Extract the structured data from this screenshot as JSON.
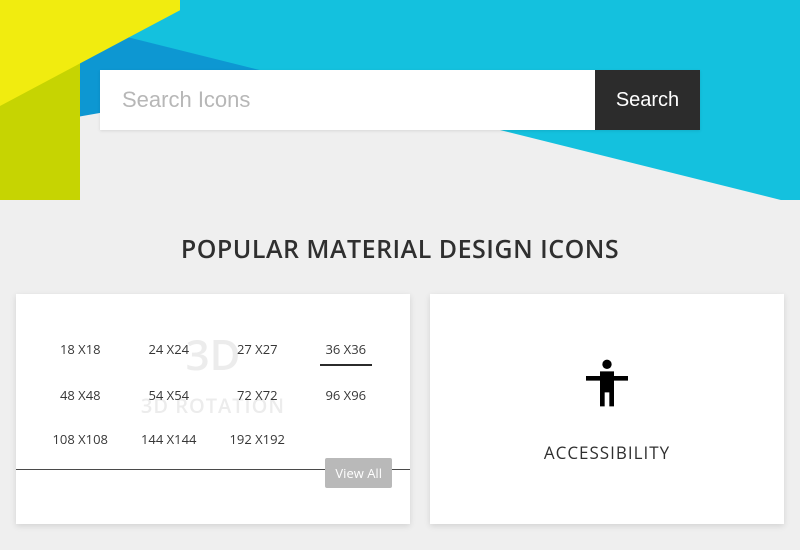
{
  "search": {
    "placeholder": "Search Icons",
    "button_label": "Search"
  },
  "section_title": "POPULAR MATERIAL DESIGN ICONS",
  "size_card": {
    "ghost_top": "3D",
    "ghost_bottom": "3D ROTATION",
    "sizes": [
      "18 X18",
      "24 X24",
      "27 X27",
      "36 X36",
      "48 X48",
      "54 X54",
      "72 X72",
      "96 X96",
      "108 X108",
      "144 X144",
      "192 X192"
    ],
    "selected_index": 3,
    "view_all_label": "View All"
  },
  "access_card": {
    "label": "ACCESSIBILITY"
  }
}
